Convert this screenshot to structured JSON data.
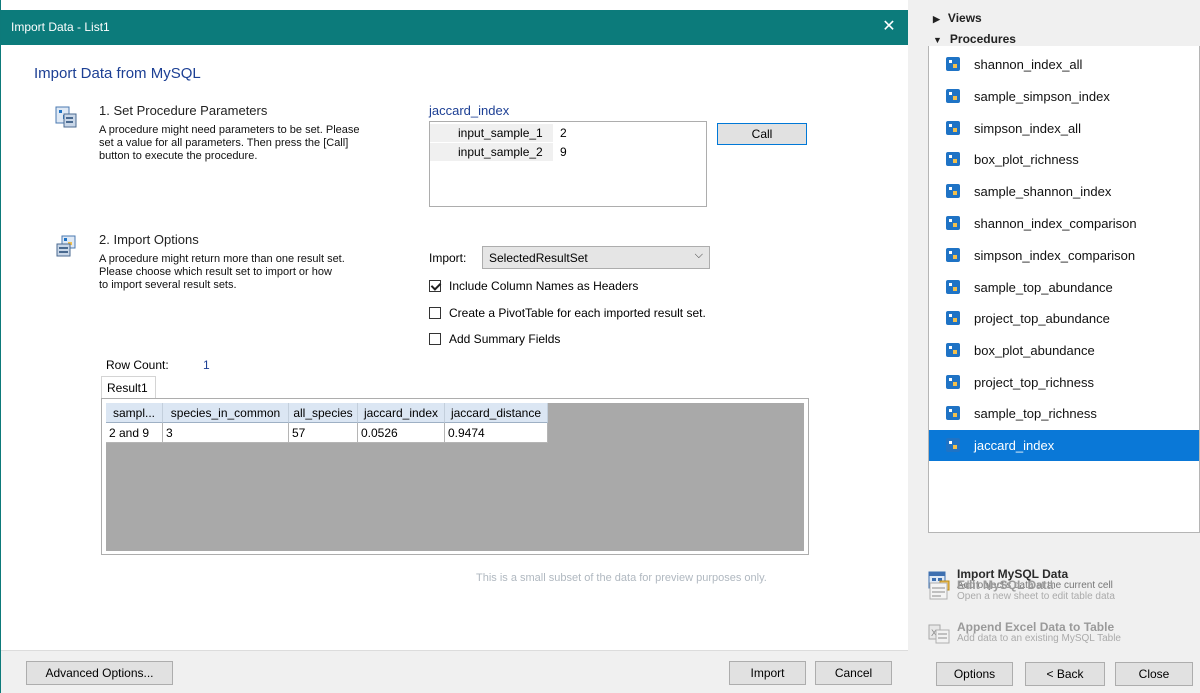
{
  "dialog": {
    "title": "Import Data - List1",
    "close_glyph": "✕",
    "heading": "Import Data from MySQL",
    "step1": {
      "title": "1. Set Procedure Parameters",
      "desc_lines": [
        "A procedure might need parameters to be set. Please",
        "set a value for all parameters. Then press the [Call]",
        "button to execute the procedure."
      ]
    },
    "step2": {
      "title": "2. Import Options",
      "desc_lines": [
        "A procedure might return more than one result set.",
        "Please choose which result set to import or how",
        "to import several result sets."
      ]
    },
    "procedure_name": "jaccard_index",
    "params": [
      {
        "name": "input_sample_1",
        "value": "2"
      },
      {
        "name": "input_sample_2",
        "value": "9"
      }
    ],
    "call_label": "Call",
    "import_label": "Import:",
    "import_select": "SelectedResultSet",
    "options": [
      {
        "label": "Include Column Names as Headers",
        "checked": true
      },
      {
        "label": "Create a PivotTable for each imported result set.",
        "checked": false
      },
      {
        "label": "Add Summary Fields",
        "checked": false
      }
    ],
    "row_count_label": "Row Count:",
    "row_count": "1",
    "result_tab": "Result1",
    "grid": {
      "headers": [
        "sampl...",
        "species_in_common",
        "all_species",
        "jaccard_index",
        "jaccard_distance"
      ],
      "rows": [
        [
          "2 and 9",
          "3",
          "57",
          "0.0526",
          "0.9474"
        ]
      ]
    },
    "preview_note": "This is a small subset of the data for preview purposes only.",
    "footer": {
      "advanced": "Advanced Options...",
      "import": "Import",
      "cancel": "Cancel"
    }
  },
  "panel": {
    "views_label": "Views",
    "procedures_label": "Procedures",
    "procedures": [
      "shannon_index_all",
      "sample_simpson_index",
      "simpson_index_all",
      "box_plot_richness",
      "sample_shannon_index",
      "shannon_index_comparison",
      "simpson_index_comparison",
      "sample_top_abundance",
      "project_top_abundance",
      "box_plot_abundance",
      "project_top_richness",
      "sample_top_richness",
      "jaccard_index"
    ],
    "selected_procedure": "jaccard_index",
    "actions": [
      {
        "title": "Import MySQL Data",
        "desc": "Add object's data at the current cell",
        "enabled": true
      },
      {
        "title": "Edit MySQL Data",
        "desc": "Open a new sheet to edit table data",
        "enabled": false
      },
      {
        "title": "Append Excel Data to Table",
        "desc": "Add data to an existing MySQL Table",
        "enabled": false
      }
    ],
    "buttons": {
      "options": "Options",
      "back": "< Back",
      "close": "Close"
    }
  },
  "colors": {
    "titlebar": "#0c7b7b",
    "accent": "#0a78d7",
    "heading": "#1c3f94"
  }
}
